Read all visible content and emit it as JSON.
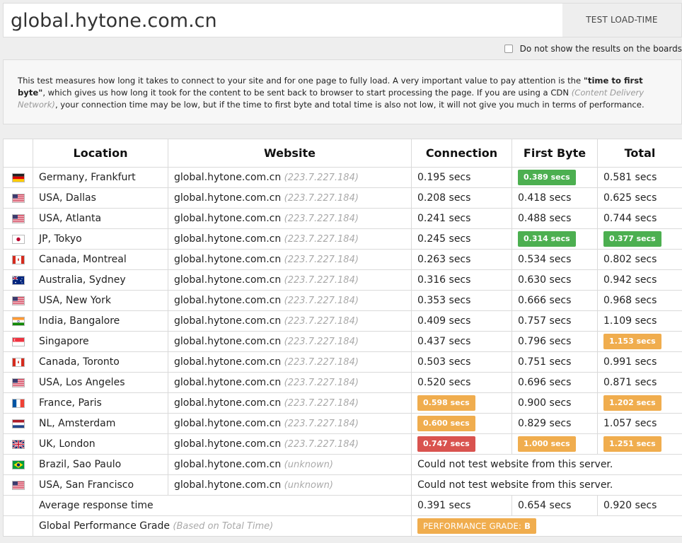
{
  "header": {
    "url_value": "global.hytone.com.cn",
    "test_button_label": "TEST LOAD-TIME"
  },
  "options": {
    "hide_results_label": "Do not show the results on the boards",
    "hide_results_checked": false
  },
  "info": {
    "text_1": "This test measures how long it takes to connect to your site and for one page to fully load. A very important value to pay attention is the ",
    "text_bold": "\"time to first byte\"",
    "text_2": ", which gives us how long it took for the content to be sent back to browser to start processing the page. If you are using a CDN ",
    "text_italic": "(Content Delivery Network)",
    "text_3": ", your connection time may be low, but if the time to first byte and total time is also not low, it will not give you much in terms of performance."
  },
  "table": {
    "headers": [
      "Location",
      "Website",
      "Connection",
      "First Byte",
      "Total"
    ],
    "rows": [
      {
        "flag": "de",
        "location": "Germany, Frankfurt",
        "site": "global.hytone.com.cn",
        "ip": "(223.7.227.184)",
        "connection": "0.195 secs",
        "first_byte": "0.389 secs",
        "first_byte_badge": "green",
        "total": "0.581 secs"
      },
      {
        "flag": "us",
        "location": "USA, Dallas",
        "site": "global.hytone.com.cn",
        "ip": "(223.7.227.184)",
        "connection": "0.208 secs",
        "first_byte": "0.418 secs",
        "total": "0.625 secs"
      },
      {
        "flag": "us",
        "location": "USA, Atlanta",
        "site": "global.hytone.com.cn",
        "ip": "(223.7.227.184)",
        "connection": "0.241 secs",
        "first_byte": "0.488 secs",
        "total": "0.744 secs"
      },
      {
        "flag": "jp",
        "location": "JP, Tokyo",
        "site": "global.hytone.com.cn",
        "ip": "(223.7.227.184)",
        "connection": "0.245 secs",
        "first_byte": "0.314 secs",
        "first_byte_badge": "green",
        "total": "0.377 secs",
        "total_badge": "green"
      },
      {
        "flag": "ca",
        "location": "Canada, Montreal",
        "site": "global.hytone.com.cn",
        "ip": "(223.7.227.184)",
        "connection": "0.263 secs",
        "first_byte": "0.534 secs",
        "total": "0.802 secs"
      },
      {
        "flag": "au",
        "location": "Australia, Sydney",
        "site": "global.hytone.com.cn",
        "ip": "(223.7.227.184)",
        "connection": "0.316 secs",
        "first_byte": "0.630 secs",
        "total": "0.942 secs"
      },
      {
        "flag": "us",
        "location": "USA, New York",
        "site": "global.hytone.com.cn",
        "ip": "(223.7.227.184)",
        "connection": "0.353 secs",
        "first_byte": "0.666 secs",
        "total": "0.968 secs"
      },
      {
        "flag": "in",
        "location": "India, Bangalore",
        "site": "global.hytone.com.cn",
        "ip": "(223.7.227.184)",
        "connection": "0.409 secs",
        "first_byte": "0.757 secs",
        "total": "1.109 secs"
      },
      {
        "flag": "sg",
        "location": "Singapore",
        "site": "global.hytone.com.cn",
        "ip": "(223.7.227.184)",
        "connection": "0.437 secs",
        "first_byte": "0.796 secs",
        "total": "1.153 secs",
        "total_badge": "orange"
      },
      {
        "flag": "ca",
        "location": "Canada, Toronto",
        "site": "global.hytone.com.cn",
        "ip": "(223.7.227.184)",
        "connection": "0.503 secs",
        "first_byte": "0.751 secs",
        "total": "0.991 secs"
      },
      {
        "flag": "us",
        "location": "USA, Los Angeles",
        "site": "global.hytone.com.cn",
        "ip": "(223.7.227.184)",
        "connection": "0.520 secs",
        "first_byte": "0.696 secs",
        "total": "0.871 secs"
      },
      {
        "flag": "fr",
        "location": "France, Paris",
        "site": "global.hytone.com.cn",
        "ip": "(223.7.227.184)",
        "connection": "0.598 secs",
        "connection_badge": "orange",
        "first_byte": "0.900 secs",
        "total": "1.202 secs",
        "total_badge": "orange"
      },
      {
        "flag": "nl",
        "location": "NL, Amsterdam",
        "site": "global.hytone.com.cn",
        "ip": "(223.7.227.184)",
        "connection": "0.600 secs",
        "connection_badge": "orange",
        "first_byte": "0.829 secs",
        "total": "1.057 secs"
      },
      {
        "flag": "uk",
        "location": "UK, London",
        "site": "global.hytone.com.cn",
        "ip": "(223.7.227.184)",
        "connection": "0.747 secs",
        "connection_badge": "red",
        "first_byte": "1.000 secs",
        "first_byte_badge": "orange",
        "total": "1.251 secs",
        "total_badge": "orange"
      },
      {
        "flag": "br",
        "location": "Brazil, Sao Paulo",
        "site": "global.hytone.com.cn",
        "ip": "(unknown)",
        "error": "Could not test website from this server."
      },
      {
        "flag": "us",
        "location": "USA, San Francisco",
        "site": "global.hytone.com.cn",
        "ip": "(unknown)",
        "error": "Could not test website from this server."
      }
    ],
    "average": {
      "label": "Average response time",
      "connection": "0.391 secs",
      "first_byte": "0.654 secs",
      "total": "0.920 secs"
    },
    "grade": {
      "label": "Global Performance Grade",
      "note": "(Based on Total Time)",
      "badge_label": "PERFORMANCE GRADE:",
      "badge_value": "B"
    }
  },
  "colors": {
    "green": "#4caf50",
    "orange": "#f0ad4e",
    "red": "#d9534f"
  }
}
